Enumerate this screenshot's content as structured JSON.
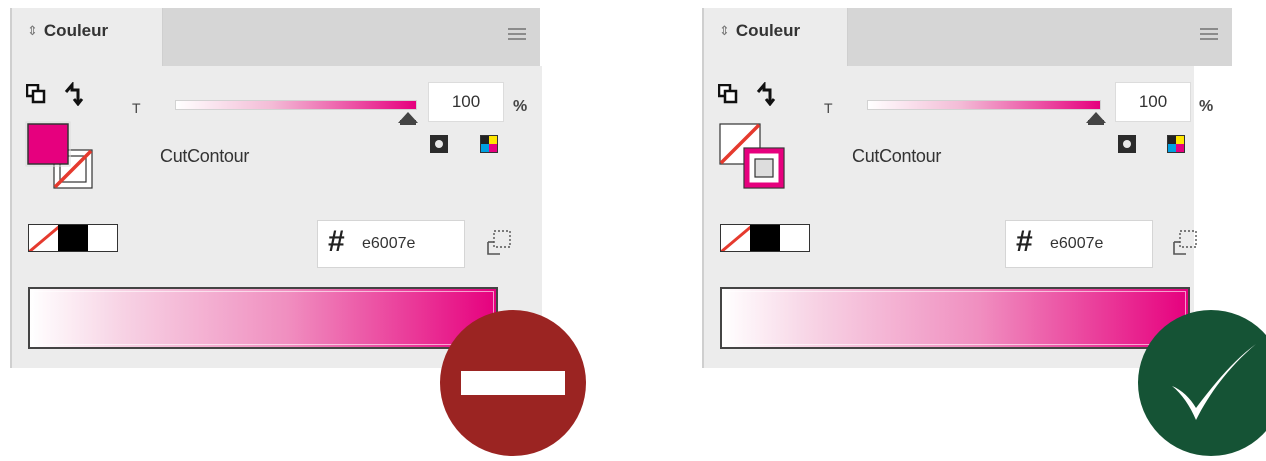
{
  "colors": {
    "accent": "#e6007e",
    "none_red": "#e53a2e",
    "panel_bg": "#ececec",
    "badge_wrong": "#9b2422",
    "badge_right": "#155335"
  },
  "panels": [
    {
      "tab": {
        "label": "Couleur",
        "collapse_icon": "⇕"
      },
      "tint": {
        "label": "T",
        "value": "100",
        "unit": "%",
        "fraction": 1.0
      },
      "swatch_name": "CutContour",
      "hex": {
        "prefix": "#",
        "value": "e6007e"
      },
      "fill_stroke_state": "fill-active",
      "badge": "no-entry-icon"
    },
    {
      "tab": {
        "label": "Couleur",
        "collapse_icon": "⇕"
      },
      "tint": {
        "label": "T",
        "value": "100",
        "unit": "%",
        "fraction": 1.0
      },
      "swatch_name": "CutContour",
      "hex": {
        "prefix": "#",
        "value": "e6007e"
      },
      "fill_stroke_state": "stroke-active",
      "badge": "checkmark-icon"
    }
  ]
}
